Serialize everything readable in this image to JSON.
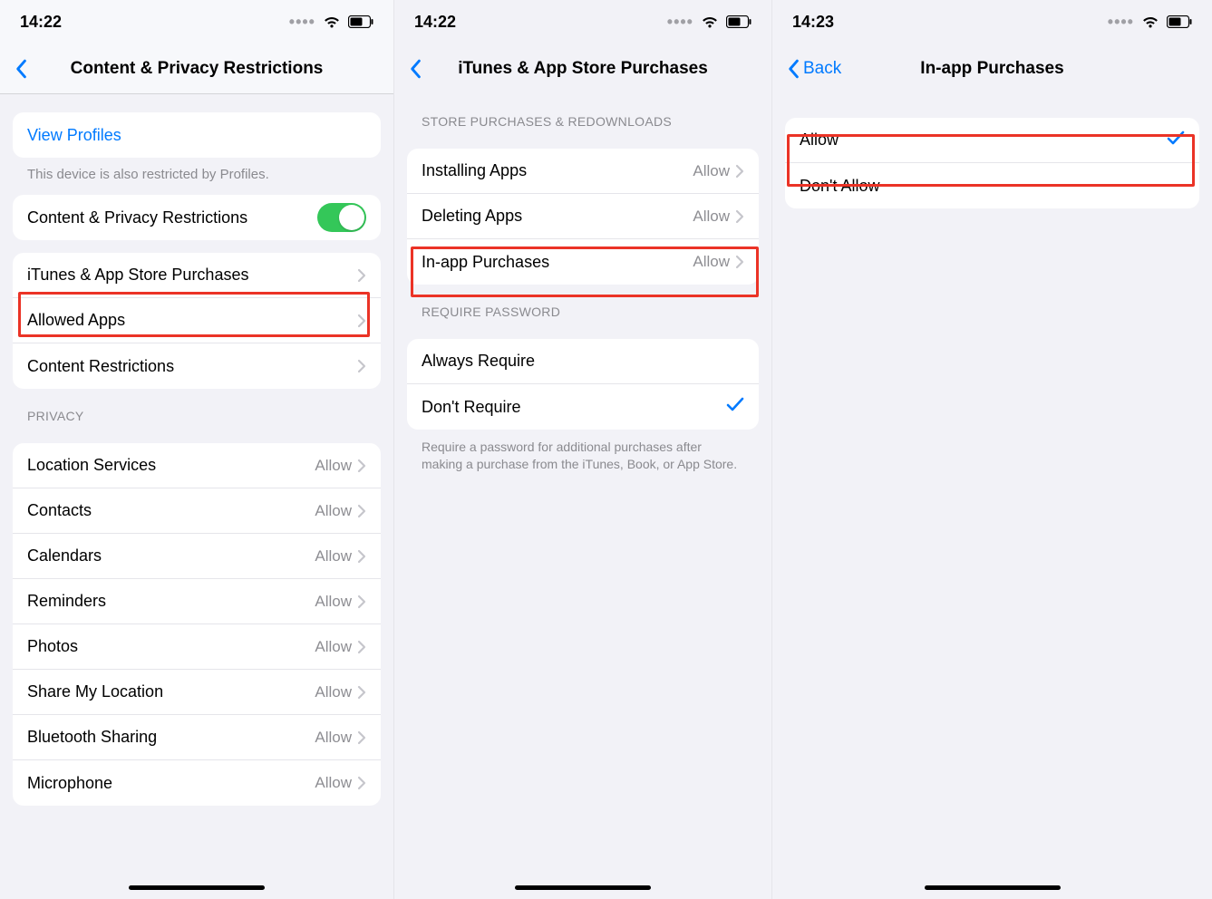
{
  "screen1": {
    "time": "14:22",
    "title": "Content & Privacy Restrictions",
    "viewProfiles": "View Profiles",
    "note": "This device is also restricted by Profiles.",
    "toggleLabel": "Content & Privacy Restrictions",
    "items1": [
      {
        "label": "iTunes & App Store Purchases"
      },
      {
        "label": "Allowed Apps"
      },
      {
        "label": "Content Restrictions"
      }
    ],
    "privacyHeader": "PRIVACY",
    "privacyItems": [
      {
        "label": "Location Services",
        "value": "Allow"
      },
      {
        "label": "Contacts",
        "value": "Allow"
      },
      {
        "label": "Calendars",
        "value": "Allow"
      },
      {
        "label": "Reminders",
        "value": "Allow"
      },
      {
        "label": "Photos",
        "value": "Allow"
      },
      {
        "label": "Share My Location",
        "value": "Allow"
      },
      {
        "label": "Bluetooth Sharing",
        "value": "Allow"
      },
      {
        "label": "Microphone",
        "value": "Allow"
      }
    ]
  },
  "screen2": {
    "time": "14:22",
    "title": "iTunes & App Store Purchases",
    "section1Header": "STORE PURCHASES & REDOWNLOADS",
    "storeItems": [
      {
        "label": "Installing Apps",
        "value": "Allow"
      },
      {
        "label": "Deleting Apps",
        "value": "Allow"
      },
      {
        "label": "In-app Purchases",
        "value": "Allow"
      }
    ],
    "section2Header": "REQUIRE PASSWORD",
    "passwordItems": [
      {
        "label": "Always Require",
        "checked": false
      },
      {
        "label": "Don't Require",
        "checked": true
      }
    ],
    "footer": "Require a password for additional purchases after making a purchase from the iTunes, Book, or App Store."
  },
  "screen3": {
    "time": "14:23",
    "backLabel": "Back",
    "title": "In-app Purchases",
    "options": [
      {
        "label": "Allow",
        "checked": true
      },
      {
        "label": "Don't Allow",
        "checked": false
      }
    ]
  }
}
